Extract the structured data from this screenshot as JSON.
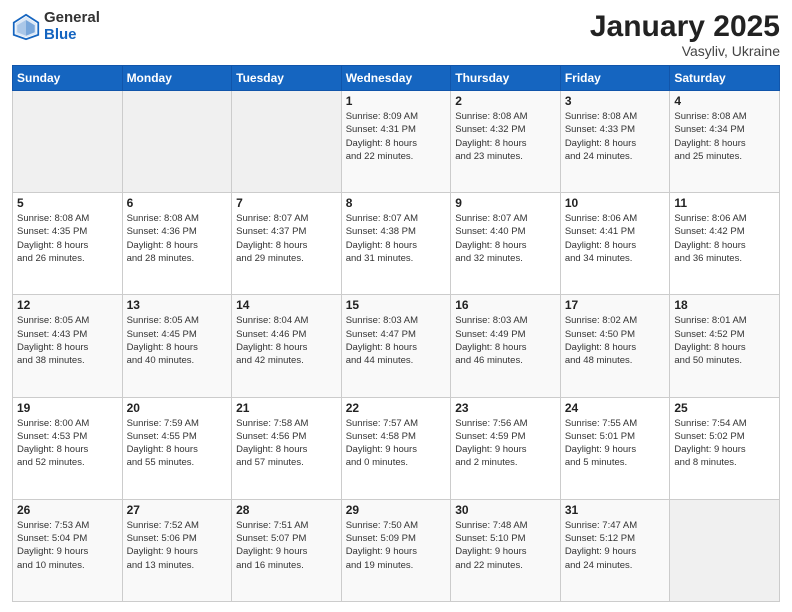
{
  "header": {
    "logo_general": "General",
    "logo_blue": "Blue",
    "month_title": "January 2025",
    "location": "Vasyliv, Ukraine"
  },
  "days_of_week": [
    "Sunday",
    "Monday",
    "Tuesday",
    "Wednesday",
    "Thursday",
    "Friday",
    "Saturday"
  ],
  "weeks": [
    [
      {
        "num": "",
        "info": ""
      },
      {
        "num": "",
        "info": ""
      },
      {
        "num": "",
        "info": ""
      },
      {
        "num": "1",
        "info": "Sunrise: 8:09 AM\nSunset: 4:31 PM\nDaylight: 8 hours\nand 22 minutes."
      },
      {
        "num": "2",
        "info": "Sunrise: 8:08 AM\nSunset: 4:32 PM\nDaylight: 8 hours\nand 23 minutes."
      },
      {
        "num": "3",
        "info": "Sunrise: 8:08 AM\nSunset: 4:33 PM\nDaylight: 8 hours\nand 24 minutes."
      },
      {
        "num": "4",
        "info": "Sunrise: 8:08 AM\nSunset: 4:34 PM\nDaylight: 8 hours\nand 25 minutes."
      }
    ],
    [
      {
        "num": "5",
        "info": "Sunrise: 8:08 AM\nSunset: 4:35 PM\nDaylight: 8 hours\nand 26 minutes."
      },
      {
        "num": "6",
        "info": "Sunrise: 8:08 AM\nSunset: 4:36 PM\nDaylight: 8 hours\nand 28 minutes."
      },
      {
        "num": "7",
        "info": "Sunrise: 8:07 AM\nSunset: 4:37 PM\nDaylight: 8 hours\nand 29 minutes."
      },
      {
        "num": "8",
        "info": "Sunrise: 8:07 AM\nSunset: 4:38 PM\nDaylight: 8 hours\nand 31 minutes."
      },
      {
        "num": "9",
        "info": "Sunrise: 8:07 AM\nSunset: 4:40 PM\nDaylight: 8 hours\nand 32 minutes."
      },
      {
        "num": "10",
        "info": "Sunrise: 8:06 AM\nSunset: 4:41 PM\nDaylight: 8 hours\nand 34 minutes."
      },
      {
        "num": "11",
        "info": "Sunrise: 8:06 AM\nSunset: 4:42 PM\nDaylight: 8 hours\nand 36 minutes."
      }
    ],
    [
      {
        "num": "12",
        "info": "Sunrise: 8:05 AM\nSunset: 4:43 PM\nDaylight: 8 hours\nand 38 minutes."
      },
      {
        "num": "13",
        "info": "Sunrise: 8:05 AM\nSunset: 4:45 PM\nDaylight: 8 hours\nand 40 minutes."
      },
      {
        "num": "14",
        "info": "Sunrise: 8:04 AM\nSunset: 4:46 PM\nDaylight: 8 hours\nand 42 minutes."
      },
      {
        "num": "15",
        "info": "Sunrise: 8:03 AM\nSunset: 4:47 PM\nDaylight: 8 hours\nand 44 minutes."
      },
      {
        "num": "16",
        "info": "Sunrise: 8:03 AM\nSunset: 4:49 PM\nDaylight: 8 hours\nand 46 minutes."
      },
      {
        "num": "17",
        "info": "Sunrise: 8:02 AM\nSunset: 4:50 PM\nDaylight: 8 hours\nand 48 minutes."
      },
      {
        "num": "18",
        "info": "Sunrise: 8:01 AM\nSunset: 4:52 PM\nDaylight: 8 hours\nand 50 minutes."
      }
    ],
    [
      {
        "num": "19",
        "info": "Sunrise: 8:00 AM\nSunset: 4:53 PM\nDaylight: 8 hours\nand 52 minutes."
      },
      {
        "num": "20",
        "info": "Sunrise: 7:59 AM\nSunset: 4:55 PM\nDaylight: 8 hours\nand 55 minutes."
      },
      {
        "num": "21",
        "info": "Sunrise: 7:58 AM\nSunset: 4:56 PM\nDaylight: 8 hours\nand 57 minutes."
      },
      {
        "num": "22",
        "info": "Sunrise: 7:57 AM\nSunset: 4:58 PM\nDaylight: 9 hours\nand 0 minutes."
      },
      {
        "num": "23",
        "info": "Sunrise: 7:56 AM\nSunset: 4:59 PM\nDaylight: 9 hours\nand 2 minutes."
      },
      {
        "num": "24",
        "info": "Sunrise: 7:55 AM\nSunset: 5:01 PM\nDaylight: 9 hours\nand 5 minutes."
      },
      {
        "num": "25",
        "info": "Sunrise: 7:54 AM\nSunset: 5:02 PM\nDaylight: 9 hours\nand 8 minutes."
      }
    ],
    [
      {
        "num": "26",
        "info": "Sunrise: 7:53 AM\nSunset: 5:04 PM\nDaylight: 9 hours\nand 10 minutes."
      },
      {
        "num": "27",
        "info": "Sunrise: 7:52 AM\nSunset: 5:06 PM\nDaylight: 9 hours\nand 13 minutes."
      },
      {
        "num": "28",
        "info": "Sunrise: 7:51 AM\nSunset: 5:07 PM\nDaylight: 9 hours\nand 16 minutes."
      },
      {
        "num": "29",
        "info": "Sunrise: 7:50 AM\nSunset: 5:09 PM\nDaylight: 9 hours\nand 19 minutes."
      },
      {
        "num": "30",
        "info": "Sunrise: 7:48 AM\nSunset: 5:10 PM\nDaylight: 9 hours\nand 22 minutes."
      },
      {
        "num": "31",
        "info": "Sunrise: 7:47 AM\nSunset: 5:12 PM\nDaylight: 9 hours\nand 24 minutes."
      },
      {
        "num": "",
        "info": ""
      }
    ]
  ]
}
